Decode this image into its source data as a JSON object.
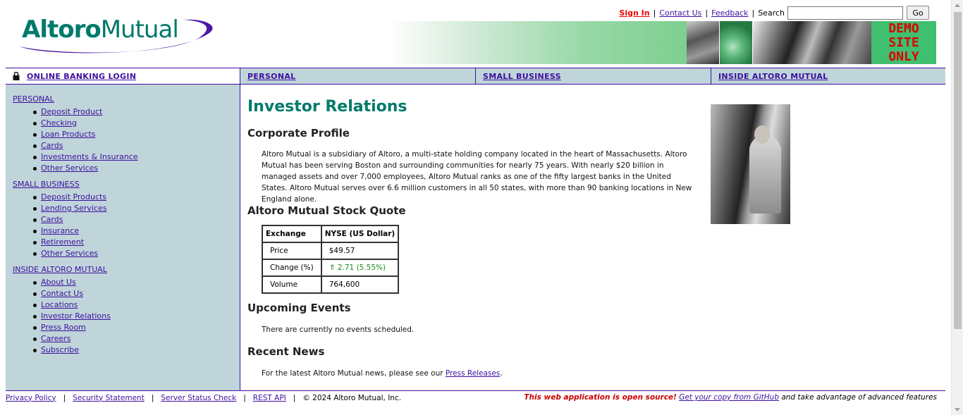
{
  "brand": {
    "logo_bold": "Altoro",
    "logo_regular": "Mutual"
  },
  "top_links": {
    "sign_in": "Sign In",
    "contact": "Contact Us",
    "feedback": "Feedback",
    "search_label": "Search",
    "search_value": "",
    "go": "Go"
  },
  "demo_badge": [
    "DEMO",
    "SITE",
    "ONLY"
  ],
  "nav": {
    "login": "ONLINE BANKING LOGIN",
    "personal": "PERSONAL",
    "small_business": "SMALL BUSINESS",
    "inside": "INSIDE ALTORO MUTUAL"
  },
  "sidebar": {
    "sections": [
      {
        "title": "PERSONAL",
        "items": [
          "Deposit Product",
          "Checking",
          "Loan Products",
          "Cards",
          "Investments & Insurance",
          "Other Services"
        ]
      },
      {
        "title": "SMALL BUSINESS",
        "items": [
          "Deposit Products",
          "Lending Services",
          "Cards",
          "Insurance",
          "Retirement",
          "Other Services"
        ]
      },
      {
        "title": "INSIDE ALTORO MUTUAL",
        "items": [
          "About Us",
          "Contact Us",
          "Locations",
          "Investor Relations",
          "Press Room",
          "Careers",
          "Subscribe"
        ]
      }
    ]
  },
  "main": {
    "title": "Investor Relations",
    "profile_heading": "Corporate Profile",
    "profile_text": "Altoro Mutual is a subsidiary of Altoro, a multi-state holding company located in the heart of Massachusetts. Altoro Mutual has been serving Boston and surrounding communities for nearly 75 years. With nearly $20 billion in managed assets and over 7,000 employees, Altoro Mutual ranks as one of the fifty largest banks in the United States. Altoro Mutual serves over 6.6 million customers in all 50 states, with more than 90 banking locations in New England alone.",
    "stock_heading": "Altoro Mutual Stock Quote",
    "stock": {
      "header_exchange": "Exchange",
      "header_market": "NYSE (US Dollar)",
      "rows": [
        {
          "label": "Price",
          "value": "$49.57"
        },
        {
          "label": "Change (%)",
          "value": "⇑ 2.71 (5.55%)"
        },
        {
          "label": "Volume",
          "value": "764,600"
        }
      ]
    },
    "events_heading": "Upcoming Events",
    "events_text": "There are currently no events scheduled.",
    "news_heading": "Recent News",
    "news_text_before": "For the latest Altoro Mutual news, please see our",
    "news_link": "Press Releases",
    "news_text_after": "."
  },
  "footer": {
    "links": [
      "Privacy Policy",
      "Security Statement",
      "Server Status Check",
      "REST API"
    ],
    "copyright": "© 2024 Altoro Mutual, Inc.",
    "open_source": "This web application is open source!",
    "github_link": "Get your copy from GitHub",
    "tail": "and take advantage of advanced features"
  },
  "colors": {
    "brand_teal": "#007a6b",
    "nav_bg": "#bfd5da",
    "link": "#3e0f9f",
    "accent_purple": "#4b19a8",
    "demo_red": "#dd0000"
  }
}
